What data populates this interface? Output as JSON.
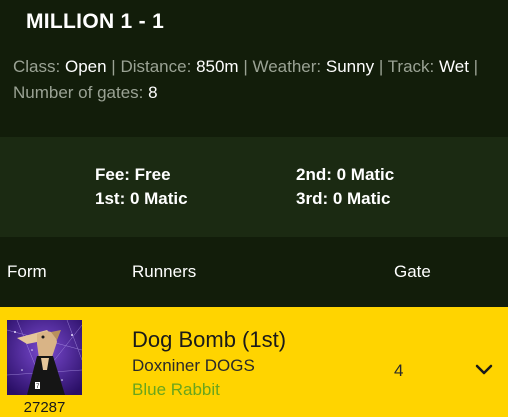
{
  "race": {
    "title": "MILLION 1 - 1",
    "class_label": "Class:",
    "class_value": "Open",
    "distance_label": "Distance:",
    "distance_value": "850m",
    "weather_label": "Weather:",
    "weather_value": "Sunny",
    "track_label": "Track:",
    "track_value": "Wet",
    "gates_label": "Number of gates:",
    "gates_value": "8",
    "separator": "|"
  },
  "fees": {
    "fee": "Fee: Free",
    "first": "1st: 0 Matic",
    "second": "2nd: 0 Matic",
    "third": "3rd: 0 Matic"
  },
  "table": {
    "headers": {
      "form": "Form",
      "runners": "Runners",
      "gate": "Gate"
    },
    "rows": [
      {
        "token_id": "27287",
        "name": "Dog Bomb (1st)",
        "owner": "Doxniner DOGS",
        "trainer": "Blue Rabbit",
        "gate": "4",
        "avatar_icon": "greyhound-avatar",
        "expand_icon": "chevron-down-icon"
      }
    ]
  },
  "colors": {
    "background": "#121d0a",
    "fee_panel": "#1b2a12",
    "highlight_row": "#ffd400",
    "trainer_text": "#6aa51c"
  }
}
